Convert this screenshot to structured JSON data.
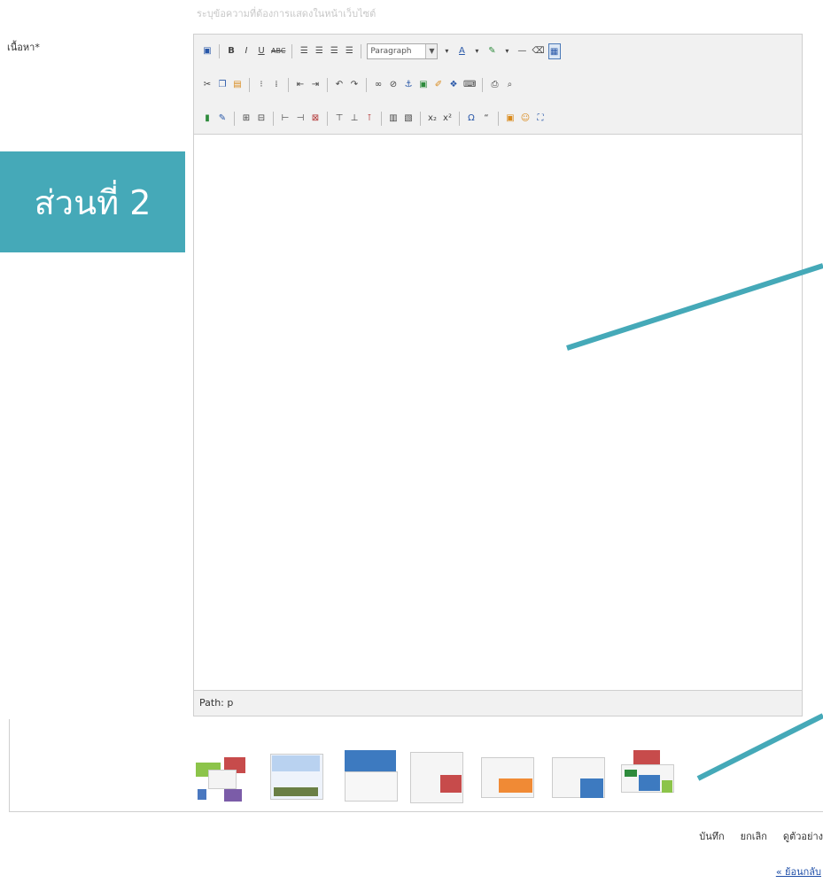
{
  "hint_text": "ระบุข้อความที่ต้องการแสดงในหน้าเว็บไซต์",
  "field_label": "เนื้อหา*",
  "section_badge": "ส่วนที่ 2",
  "toolbar": {
    "bold": "B",
    "italic": "I",
    "underline": "U",
    "strikethrough": "ABC",
    "format_select": "Paragraph",
    "text_color": "A",
    "horizontal_rule": "—",
    "subscript": "x₂",
    "superscript": "x²",
    "omega": "Ω",
    "quote": "“"
  },
  "status_bar": "Path: p",
  "actions": {
    "save": "บันทึก",
    "cancel": "ยกเลิก",
    "preview": "ดูตัวอย่าง"
  },
  "back_link": "« ย้อนกลับ",
  "colors": {
    "accent": "#45a9b8",
    "toolbar_bg": "#f1f1f1",
    "border": "#cfcfcf"
  }
}
